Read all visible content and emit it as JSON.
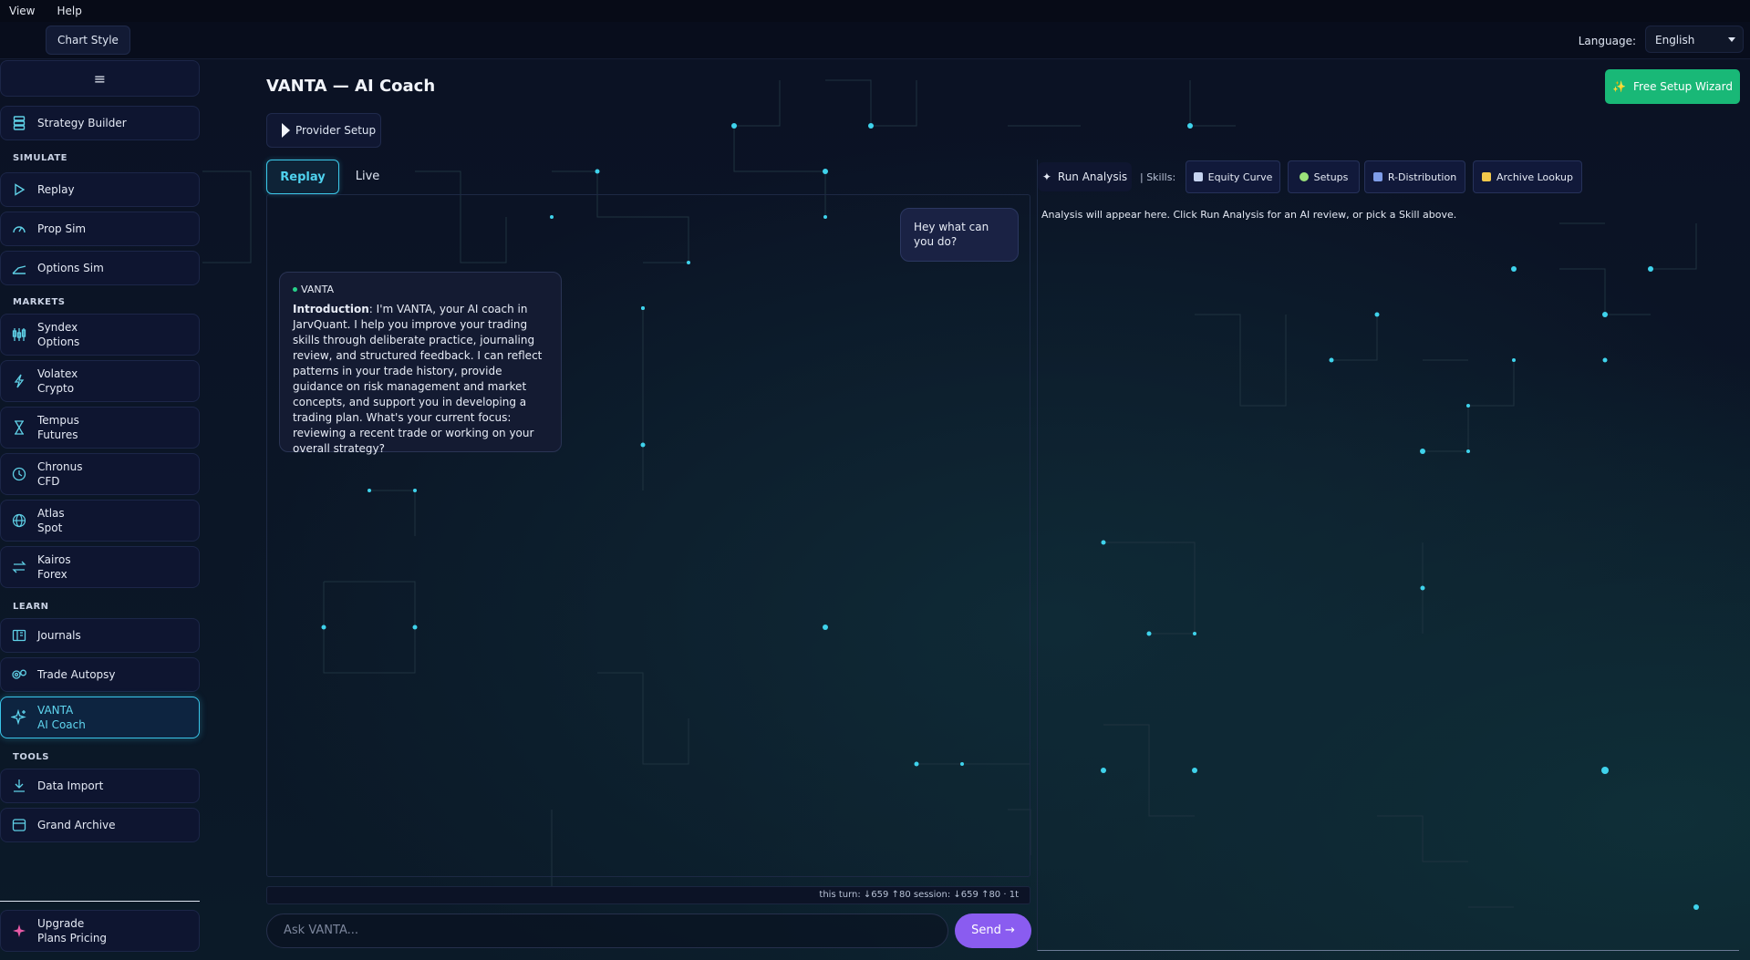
{
  "menubar": {
    "items": [
      "View",
      "Help"
    ]
  },
  "topbar": {
    "chart_style": "Chart Style",
    "language_label": "Language:",
    "language_value": "English"
  },
  "sidebar": {
    "menu_icon": "≡",
    "strategy_builder": "Strategy Builder",
    "sections": {
      "simulate": "SIMULATE",
      "markets": "MARKETS",
      "learn": "LEARN",
      "tools": "TOOLS"
    },
    "simulate": [
      "Replay",
      "Prop Sim",
      "Options Sim"
    ],
    "markets": [
      {
        "l1": "Syndex",
        "l2": "Options"
      },
      {
        "l1": "Volatex",
        "l2": "Crypto"
      },
      {
        "l1": "Tempus",
        "l2": "Futures"
      },
      {
        "l1": "Chronus",
        "l2": "CFD"
      },
      {
        "l1": "Atlas",
        "l2": "Spot"
      },
      {
        "l1": "Kairos",
        "l2": "Forex"
      }
    ],
    "learn": [
      "Journals",
      "Trade Autopsy"
    ],
    "active": {
      "l1": "VANTA",
      "l2": "AI Coach"
    },
    "tools": [
      "Data Import",
      "Grand Archive"
    ],
    "upgrade": {
      "l1": "Upgrade",
      "l2": "Plans  Pricing"
    }
  },
  "main": {
    "title": "VANTA — AI Coach",
    "provider_setup": "Provider Setup",
    "wizard": "Free Setup Wizard",
    "tabs": [
      "Replay",
      "Live"
    ]
  },
  "chat": {
    "user_message": "Hey what can you do?",
    "bot_name": "VANTA",
    "bot_lead": "Introduction",
    "bot_body": ": I'm VANTA, your AI coach in JarvQuant. I help you improve your trading skills through deliberate practice, journaling review, and structured feedback. I can reflect patterns in your trade history, provide guidance on risk management and market concepts, and support you in developing a trading plan. What's your current focus: reviewing a recent trade or working on your overall strategy?",
    "tokens": "this turn: ↓659 ↑80   session: ↓659 ↑80  ·  1t",
    "input_placeholder": "Ask VANTA...",
    "send": "Send →"
  },
  "analysis": {
    "run": "Run Analysis",
    "skills_label": "|  Skills:",
    "skills": [
      "Equity Curve",
      "Setups",
      "R-Distribution",
      "Archive Lookup"
    ],
    "placeholder": "Analysis will appear here. Click Run Analysis for an AI review, or pick a Skill above."
  },
  "colors": {
    "accent": "#39c4e8",
    "wizard": "#19b877",
    "send": "#8a5cf0"
  }
}
